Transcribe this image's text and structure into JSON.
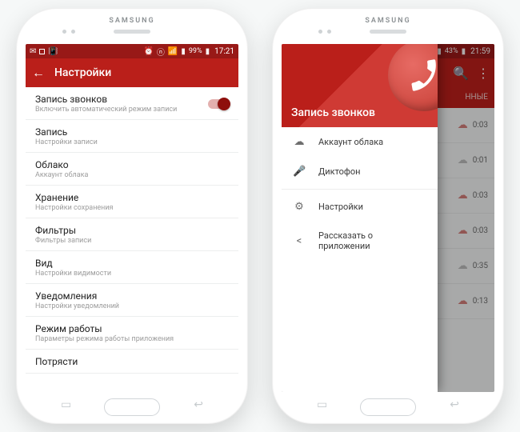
{
  "brand": "SAMSUNG",
  "left": {
    "status": {
      "battery": "99%",
      "time": "17:21"
    },
    "appbar": {
      "title": "Настройки"
    },
    "items": [
      {
        "title": "Запись звонков",
        "sub": "Включить автоматический режим записи",
        "toggle": true
      },
      {
        "title": "Запись",
        "sub": "Настройки записи"
      },
      {
        "title": "Облако",
        "sub": "Аккаунт облака"
      },
      {
        "title": "Хранение",
        "sub": "Настройки сохранения"
      },
      {
        "title": "Фильтры",
        "sub": "Фильтры записи"
      },
      {
        "title": "Вид",
        "sub": "Настройки видимости"
      },
      {
        "title": "Уведомления",
        "sub": "Настройки уведомлений"
      },
      {
        "title": "Режим работы",
        "sub": "Параметры режима работы приложения"
      },
      {
        "title": "Потрясти",
        "sub": ""
      }
    ]
  },
  "right": {
    "status": {
      "battery": "43%",
      "time": "21:59"
    },
    "bg": {
      "tab": "ННЫЕ",
      "rows": [
        {
          "dur": "0:03",
          "red": true
        },
        {
          "dur": "0:01",
          "red": false
        },
        {
          "dur": "0:03",
          "red": true
        },
        {
          "dur": "0:03",
          "red": true
        },
        {
          "dur": "0:35",
          "red": false
        },
        {
          "dur": "0:13",
          "red": true
        }
      ]
    },
    "drawer": {
      "title": "Запись звонков",
      "items": [
        {
          "icon": "cloud",
          "label": "Аккаунт облака"
        },
        {
          "icon": "mic",
          "label": "Диктофон"
        },
        {
          "icon": "gear",
          "label": "Настройки"
        },
        {
          "icon": "share",
          "label": "Рассказать о приложении"
        }
      ]
    }
  }
}
